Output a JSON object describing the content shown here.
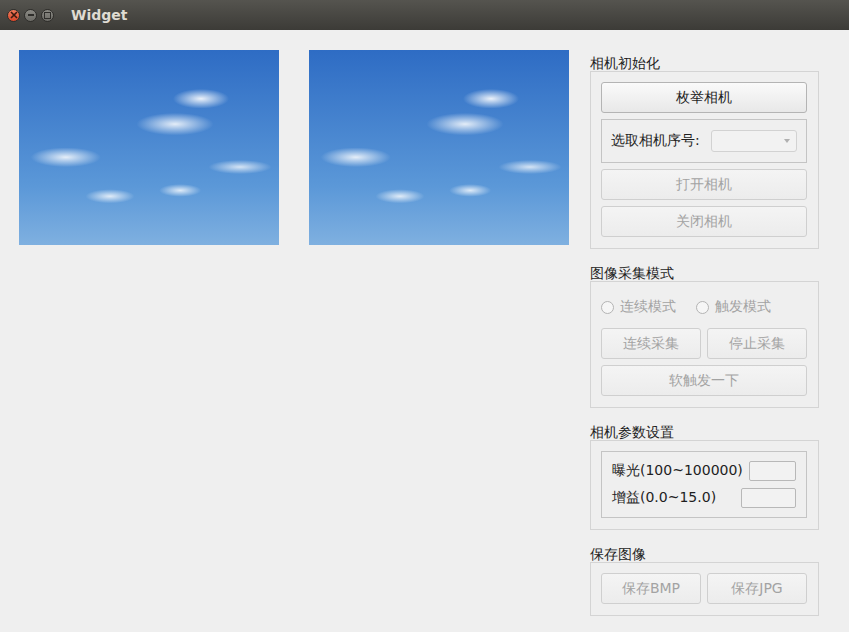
{
  "window": {
    "title": "Widget"
  },
  "camera_init": {
    "title": "相机初始化",
    "enumerate_button": {
      "label": "枚举相机",
      "disabled": false
    },
    "selector": {
      "label": "选取相机序号:",
      "value": "",
      "disabled": true
    },
    "open_button": {
      "label": "打开相机",
      "disabled": true
    },
    "close_button": {
      "label": "关闭相机",
      "disabled": true
    }
  },
  "capture_mode": {
    "title": "图像采集模式",
    "radios": [
      {
        "label": "连续模式",
        "selected": false,
        "disabled": true
      },
      {
        "label": "触发模式",
        "selected": false,
        "disabled": true
      }
    ],
    "buttons": [
      {
        "label": "连续采集",
        "disabled": true
      },
      {
        "label": "停止采集",
        "disabled": true
      }
    ],
    "trigger_button": {
      "label": "软触发一下",
      "disabled": true
    }
  },
  "params": {
    "title": "相机参数设置",
    "fields": [
      {
        "label": "曝光(100~100000)",
        "value": "",
        "disabled": false
      },
      {
        "label": "增益(0.0~15.0)",
        "value": "",
        "disabled": false
      }
    ]
  },
  "save": {
    "title": "保存图像",
    "buttons": [
      {
        "label": "保存BMP",
        "disabled": true
      },
      {
        "label": "保存JPG",
        "disabled": true
      }
    ]
  }
}
